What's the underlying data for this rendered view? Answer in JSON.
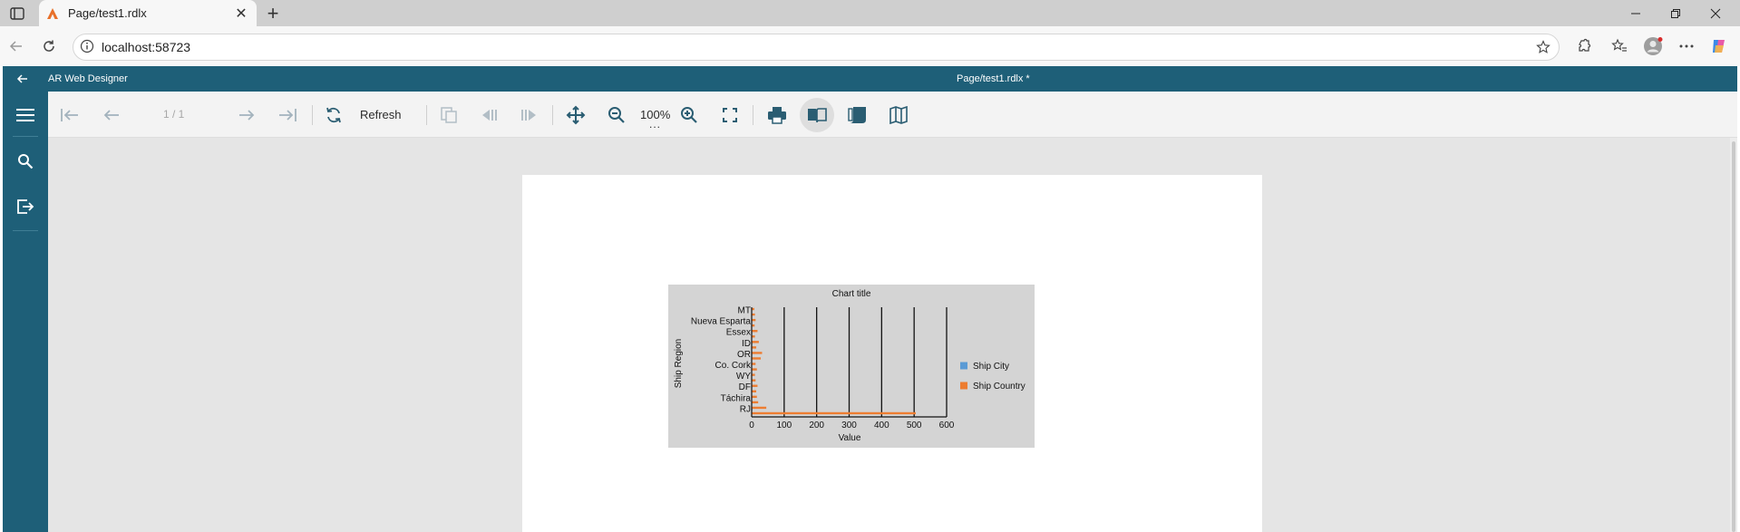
{
  "browser": {
    "tab_title": "Page/test1.rdlx",
    "url": "localhost:58723"
  },
  "app": {
    "name": "AR Web Designer",
    "doc_title": "Page/test1.rdlx *"
  },
  "toolbar": {
    "page_indicator": "1 / 1",
    "refresh_label": "Refresh",
    "zoom_label": "100%",
    "zoom_more": "..."
  },
  "colors": {
    "app_bar": "#1e5f78",
    "series_city": "#5b9bd5",
    "series_country": "#ed7d31",
    "chart_bg": "#d4d4d4"
  },
  "chart_data": {
    "type": "bar",
    "orientation": "horizontal",
    "title": "Chart title",
    "xlabel": "Value",
    "ylabel": "Ship Region",
    "xlim": [
      0,
      600
    ],
    "x_ticks": [
      "0",
      "100",
      "200",
      "300",
      "400",
      "500",
      "600"
    ],
    "categories": [
      "MT",
      "Nueva Esparta",
      "Essex",
      "ID",
      "OR",
      "Co. Cork",
      "WY",
      "DF",
      "Táchira",
      "RJ"
    ],
    "categories_all_rows": [
      "MT",
      "",
      "Nueva Esparta",
      "",
      "Essex",
      "",
      "ID",
      "",
      "OR",
      "",
      "Co. Cork",
      "",
      "WY",
      "",
      "DF",
      "",
      "Táchira",
      "",
      "RJ",
      ""
    ],
    "series": [
      {
        "name": "Ship City",
        "values": [
          1,
          1,
          1,
          1,
          2,
          1,
          2,
          1,
          2,
          1,
          1,
          1,
          1,
          1,
          2,
          1,
          1,
          2,
          3,
          1
        ]
      },
      {
        "name": "Ship Country",
        "values": [
          8,
          10,
          12,
          9,
          18,
          10,
          22,
          14,
          32,
          28,
          12,
          16,
          10,
          12,
          18,
          14,
          16,
          20,
          45,
          38
        ]
      }
    ],
    "x_long_bar": {
      "row": 19,
      "value": 505
    },
    "legend": "right",
    "grid": "vertical"
  }
}
